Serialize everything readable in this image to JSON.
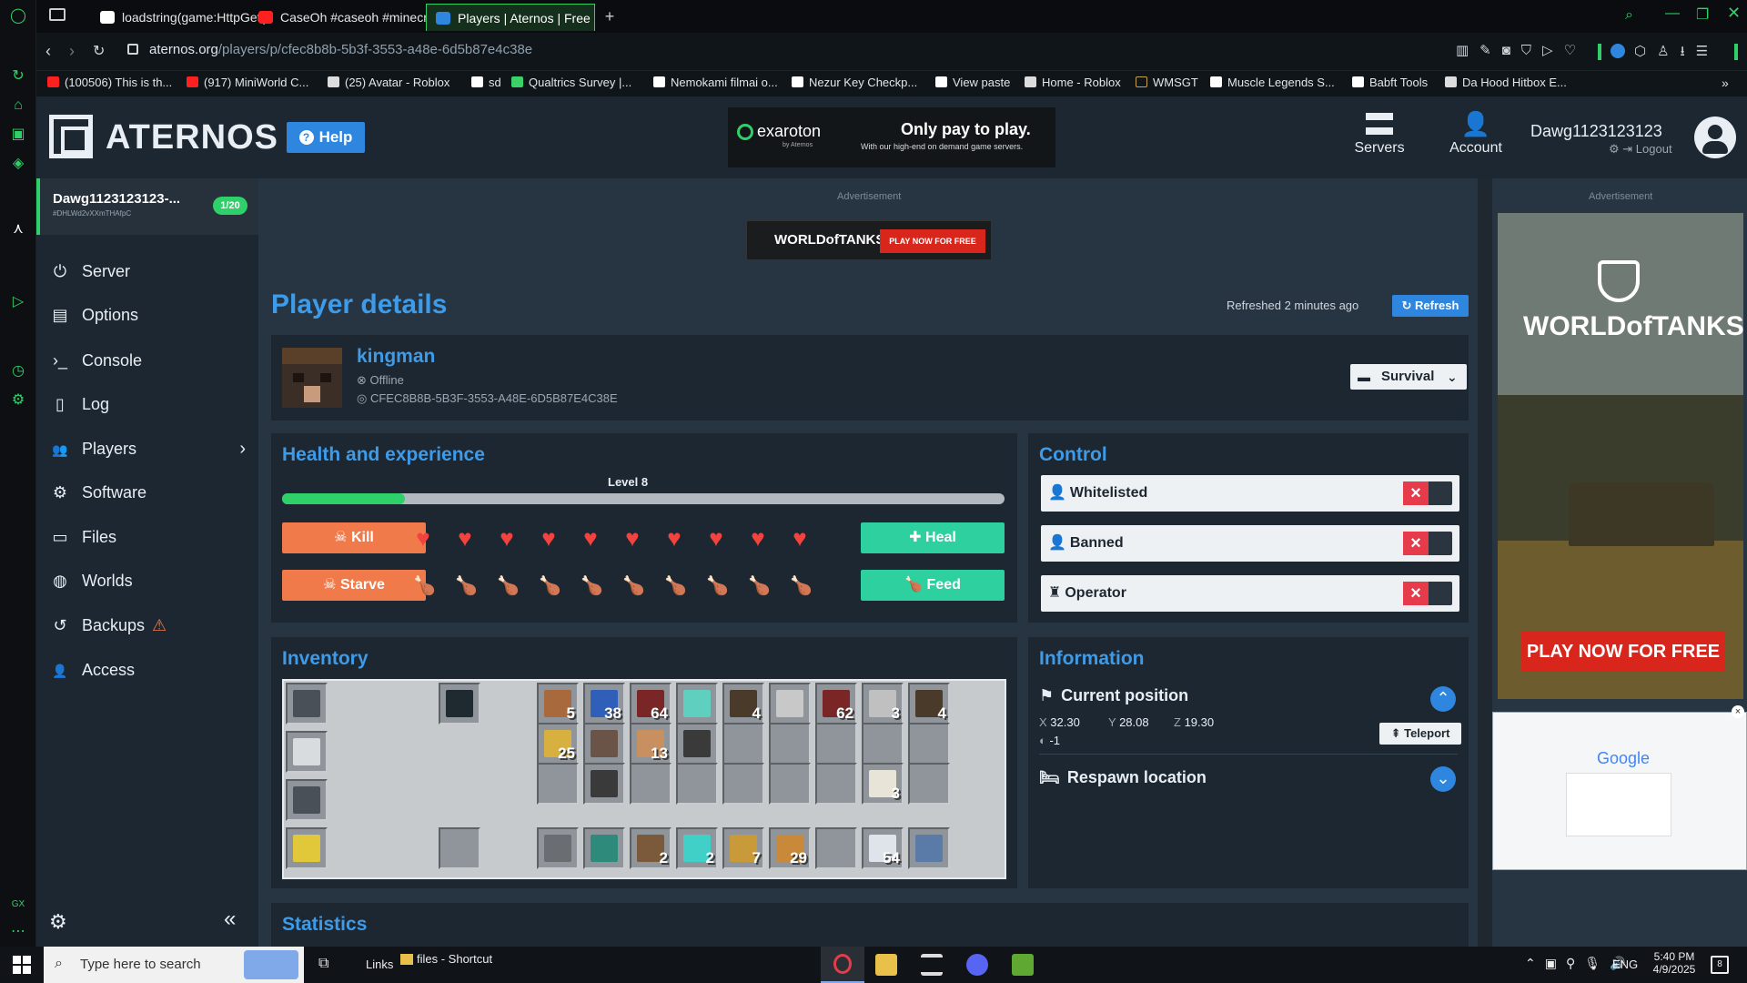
{
  "browser": {
    "tabs": [
      {
        "label": "loadstring(game:HttpGet(",
        "color": "#ffffff"
      },
      {
        "label": "CaseOh #caseoh #minecr",
        "color": "#ff2020"
      },
      {
        "label": "Players | Aternos | Free M",
        "color": "#2e86de"
      }
    ],
    "url_host": "aternos.org",
    "url_path": "/players/p/cfec8b8b-5b3f-3553-a48e-6d5b87e4c38e",
    "bookmarks": [
      {
        "label": "(100506) This is th...",
        "color": "#ff2020"
      },
      {
        "label": "(917) MiniWorld C...",
        "color": "#ff2020"
      },
      {
        "label": "(25) Avatar - Roblox",
        "color": "#dddddd"
      },
      {
        "label": "sd",
        "color": "#ffffff"
      },
      {
        "label": "Qualtrics Survey |...",
        "color": "#3ad06a"
      },
      {
        "label": "Nemokami filmai o...",
        "color": "#ffffff"
      },
      {
        "label": "Nezur Key Checkp...",
        "color": "#ffffff"
      },
      {
        "label": "View paste",
        "color": "#ffffff"
      },
      {
        "label": "Home - Roblox",
        "color": "#dddddd"
      },
      {
        "label": "WMSGT",
        "color": "#c8a24a"
      },
      {
        "label": "Muscle Legends S...",
        "color": "#ffffff"
      },
      {
        "label": "Babft Tools",
        "color": "#ffffff"
      },
      {
        "label": "Da Hood Hitbox E...",
        "color": "#dddddd"
      }
    ]
  },
  "header": {
    "logo": "ATERNOS",
    "help": "Help",
    "ad_brand": "exaroton",
    "ad_brand_sub": "by Aternos",
    "ad_headline": "Only pay to play.",
    "ad_sub": "With our high-end on demand game servers.",
    "nav_servers": "Servers",
    "nav_account": "Account",
    "username": "Dawg1123123123",
    "logout": "Logout"
  },
  "sidebar": {
    "server_name": "Dawg1123123123-...",
    "server_id": "#DHLWd2vXXmTHAfpC",
    "player_count": "1/20",
    "items": [
      {
        "label": "Server",
        "icon": "power-icon",
        "glyph": "⏻"
      },
      {
        "label": "Options",
        "icon": "options-icon",
        "glyph": "▤"
      },
      {
        "label": "Console",
        "icon": "terminal-icon",
        "glyph": "›_"
      },
      {
        "label": "Log",
        "icon": "file-icon",
        "glyph": "▯"
      },
      {
        "label": "Players",
        "icon": "users-icon",
        "glyph": "👥"
      },
      {
        "label": "Software",
        "icon": "cogs-icon",
        "glyph": "⚙"
      },
      {
        "label": "Files",
        "icon": "files-icon",
        "glyph": "▭"
      },
      {
        "label": "Worlds",
        "icon": "globe-icon",
        "glyph": "◍"
      },
      {
        "label": "Backups",
        "icon": "history-icon",
        "glyph": "↺"
      },
      {
        "label": "Access",
        "icon": "user-access-icon",
        "glyph": "👤"
      }
    ]
  },
  "main": {
    "ad_label": "Advertisement",
    "ad_wot_brand": "WORLDofTANKS",
    "ad_wot_cta": "PLAY NOW FOR FREE",
    "page_title": "Player details",
    "refreshed": "Refreshed 2 minutes ago",
    "refresh_btn": "Refresh",
    "player": {
      "name": "kingman",
      "status": "Offline",
      "uuid": "CFEC8B8B-5B3F-3553-A48E-6D5B87E4C38E",
      "gamemode": "Survival"
    },
    "health": {
      "title": "Health and experience",
      "level": "Level 8",
      "xp_fraction": 0.17,
      "kill": "Kill",
      "heal": "Heal",
      "starve": "Starve",
      "feed": "Feed",
      "hearts_full": 10,
      "food_full": 8,
      "food_total": 10
    },
    "control": {
      "title": "Control",
      "rows": [
        {
          "label": "Whitelisted",
          "icon": "user-check-icon"
        },
        {
          "label": "Banned",
          "icon": "user-slash-icon"
        },
        {
          "label": "Operator",
          "icon": "chess-icon"
        }
      ],
      "toggle_glyph": "×"
    },
    "inventory": {
      "title": "Inventory",
      "counts": [
        "5",
        "38",
        "64",
        "",
        "4",
        "",
        "62",
        "3",
        "4",
        "25",
        "",
        "13",
        "",
        "",
        "",
        "",
        "",
        "",
        "",
        "",
        "",
        "",
        "",
        "",
        "",
        "3",
        "",
        "",
        "",
        "2",
        "2",
        "7",
        "29",
        "",
        "54",
        ""
      ]
    },
    "information": {
      "title": "Information",
      "current_position": "Current position",
      "x_label": "X",
      "x": "32.30",
      "y_label": "Y",
      "y": "28.08",
      "z_label": "Z",
      "z": "19.30",
      "dimension": "-1",
      "teleport": "Teleport",
      "respawn": "Respawn location"
    },
    "statistics_title": "Statistics"
  },
  "aside_ad": {
    "label": "Advertisement",
    "brand": "WORLDofTANKS",
    "cta": "PLAY NOW FOR FREE",
    "popup_brand": "Google"
  },
  "taskbar": {
    "search_placeholder": "Type here to search",
    "links": "Links",
    "shortcut": "files - Shortcut",
    "lang": "ENG",
    "time": "5:40 PM",
    "date": "4/9/2025",
    "notif": "8"
  }
}
